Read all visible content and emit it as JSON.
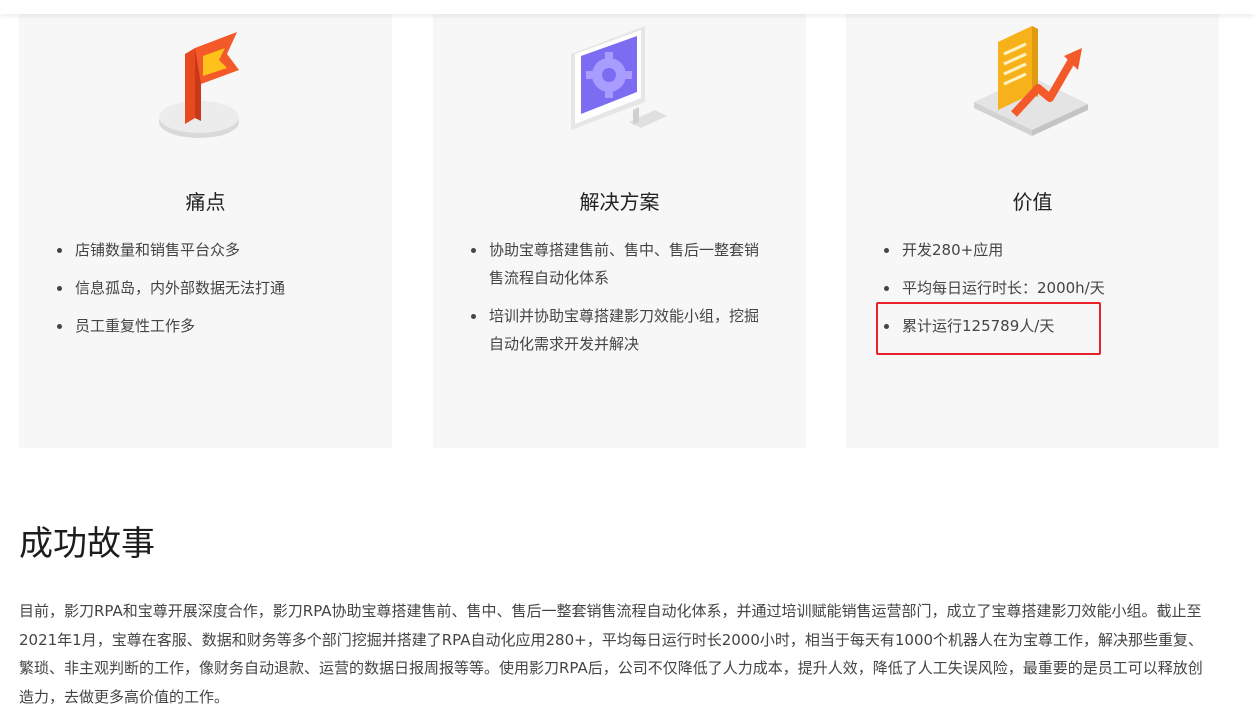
{
  "cards": [
    {
      "title": "痛点",
      "icon": "flag-icon",
      "items": [
        "店铺数量和销售平台众多",
        "信息孤岛，内外部数据无法打通",
        "员工重复性工作多"
      ]
    },
    {
      "title": "解决方案",
      "icon": "monitor-gear-icon",
      "items": [
        "协助宝尊搭建售前、售中、售后一整套销售流程自动化体系",
        "培训并协助宝尊搭建影刀效能小组，挖掘自动化需求开发并解决"
      ]
    },
    {
      "title": "价值",
      "icon": "document-growth-icon",
      "items": [
        "开发280+应用",
        "平均每日运行时长：2000h/天",
        "累计运行125789人/天"
      ]
    }
  ],
  "success": {
    "title": "成功故事",
    "text": "目前，影刀RPA和宝尊开展深度合作，影刀RPA协助宝尊搭建售前、售中、售后一整套销售流程自动化体系，并通过培训赋能销售运营部门，成立了宝尊搭建影刀效能小组。截止至2021年1月，宝尊在客服、数据和财务等多个部门挖掘并搭建了RPA自动化应用280+，平均每日运行时长2000小时，相当于每天有1000个机器人在为宝尊工作，解决那些重复、繁琐、非主观判断的工作，像财务自动退款、运营的数据日报周报等等。使用影刀RPA后，公司不仅降低了人力成本，提升人效，降低了人工失误风险，最重要的是员工可以释放创造力，去做更多高价值的工作。"
  },
  "colors": {
    "card_bg": "#f7f7f7",
    "highlight": "#e8212a",
    "flag": "#f4592a",
    "gear": "#7b6cf2",
    "doc": "#f7b21b"
  }
}
